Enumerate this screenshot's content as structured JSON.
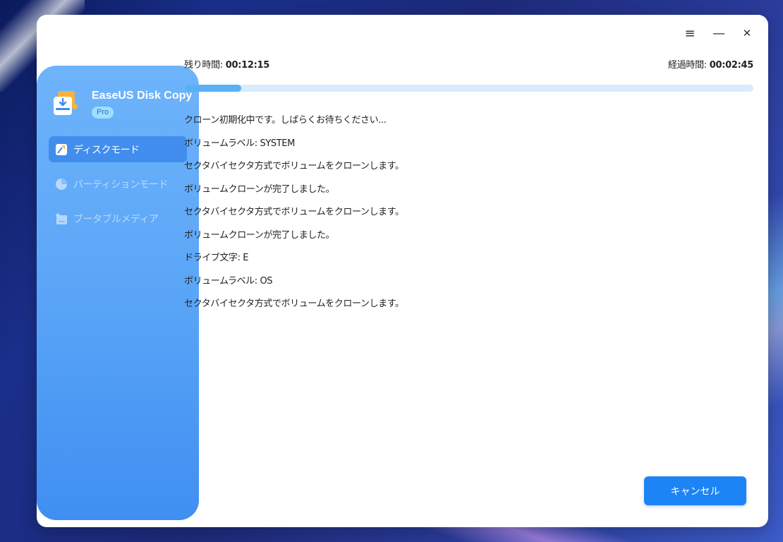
{
  "app": {
    "title": "EaseUS Disk Copy",
    "badge": "Pro"
  },
  "sidebar": {
    "items": [
      {
        "label": "ディスクモード",
        "icon": "disk-mode-icon",
        "active": true
      },
      {
        "label": "パーティションモード",
        "icon": "partition-pie-icon",
        "active": false
      },
      {
        "label": "ブータブルメディア",
        "icon": "bootable-media-icon",
        "active": false
      }
    ]
  },
  "titlebar": {
    "menu_icon": "≡",
    "minimize_icon": "—",
    "close_icon": "✕"
  },
  "progress": {
    "remaining_label": "残り時間: ",
    "remaining_value": "00:12:15",
    "elapsed_label": "経過時間: ",
    "elapsed_value": "00:02:45",
    "fraction": 0.1
  },
  "log": [
    "クローン初期化中です。しばらくお待ちください...",
    "ボリュームラベル: SYSTEM",
    "セクタバイセクタ方式でボリュームをクローンします。",
    "ボリュームクローンが完了しました。",
    "セクタバイセクタ方式でボリュームをクローンします。",
    "ボリュームクローンが完了しました。",
    "ドライブ文字: E",
    "ボリュームラベル: OS",
    "セクタバイセクタ方式でボリュームをクローンします。"
  ],
  "actions": {
    "cancel_label": "キャンセル"
  },
  "colors": {
    "accent": "#1d84f5",
    "sidebar_top": "#6eb4fb",
    "sidebar_bottom": "#3f8ff2",
    "progress_fill": "#5ab0f5",
    "progress_track": "#d7ecfd"
  }
}
